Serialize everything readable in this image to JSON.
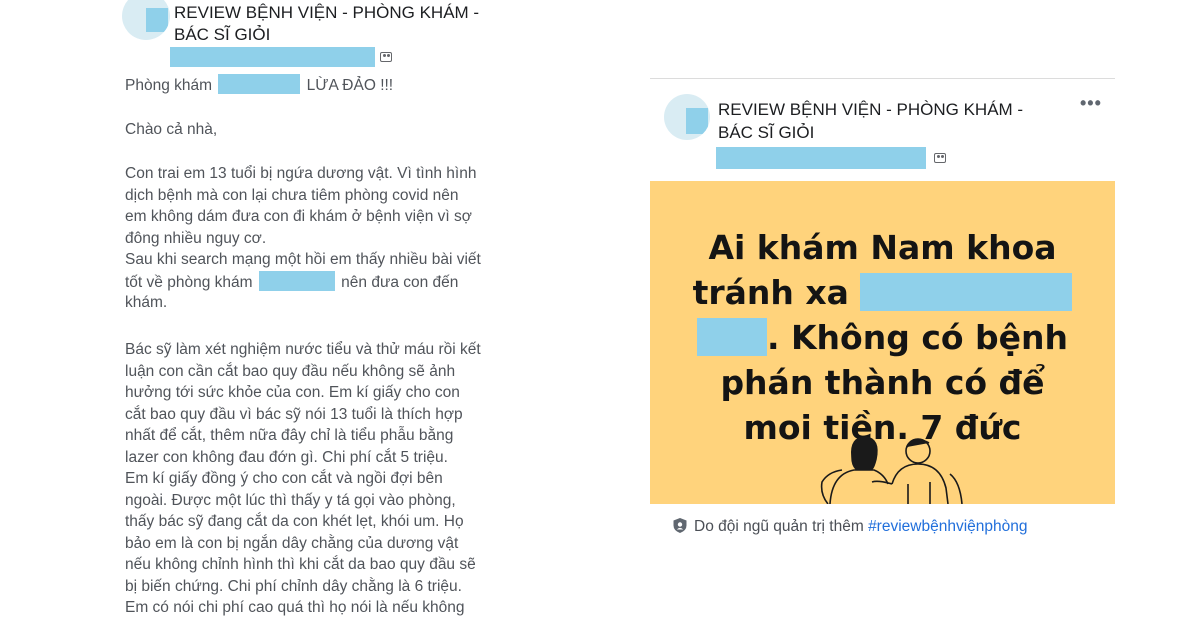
{
  "left_post": {
    "group_name_line1": "REVIEW BỆNH VIỆN - PHÒNG KHÁM -",
    "group_name_line2": "BÁC SĨ GIỎI",
    "title_prefix": "Phòng khám",
    "title_suffix": "LỪA ĐẢO !!!",
    "greeting": "Chào cả nhà,",
    "p1": [
      "Con trai em 13 tuổi bị ngứa dương vật. Vì tình hình",
      "dịch bệnh mà con lại chưa tiêm phòng covid nên",
      "em không dám đưa con đi khám ở bệnh viện vì sợ",
      "đông nhiều nguy cơ.",
      "Sau khi search mạng một hồi em thấy nhiều bài viết"
    ],
    "p1_line6_prefix": "tốt về phòng khám",
    "p1_line6_suffix": "nên đưa con đến",
    "p1_line7": "khám.",
    "p2": [
      "Bác sỹ làm xét nghiệm nước tiểu và thử máu rồi kết",
      "luận con cần cắt bao quy đầu nếu không sẽ ảnh",
      "hưởng tới sức khỏe của con.  Em kí giấy cho con",
      "cắt bao quy đầu vì bác sỹ nói 13 tuổi là thích hợp",
      "nhất để cắt, thêm nữa đây chỉ là tiểu phẫu bằng",
      "lazer  con không đau đớn gì. Chi phí cắt 5 triệu.",
      "Em kí giấy đồng ý cho con cắt và ngồi đợi bên",
      "ngoài. Được một lúc thì thấy y tá gọi vào phòng,",
      "thấy bác sỹ đang cắt da con khét lẹt, khói um. Họ",
      "bảo em là con bị ngắn dây chằng của dương vật",
      "nếu không chỉnh hình thì khi cắt da bao quy đầu sẽ",
      "bị biến chứng. Chi phí chỉnh dây chằng là 6 triệu.",
      "Em có nói chi phí cao quá thì họ nói là nếu không"
    ]
  },
  "right_post": {
    "group_name_line1": "REVIEW BỆNH VIỆN - PHÒNG KHÁM -",
    "group_name_line2": "BÁC SĨ GIỎI",
    "more_label": "•••",
    "headline_line1": "Ai khám Nam khoa",
    "headline_line2_prefix": "tránh xa",
    "headline_line3_suffix": ". Không có bệnh",
    "headline_line4": "phán thành có để",
    "headline_line5": "moi tiền. 7 đức",
    "footer_text": "Do đội ngũ quản trị thêm",
    "footer_hashtag": "#reviewbệnhviệnphòng"
  },
  "colors": {
    "redaction": "#8fd0ea",
    "image_background": "#ffd37c",
    "hashtag": "#216fdb"
  },
  "icons": [
    "group-icon",
    "shield-icon",
    "more-options-icon"
  ]
}
